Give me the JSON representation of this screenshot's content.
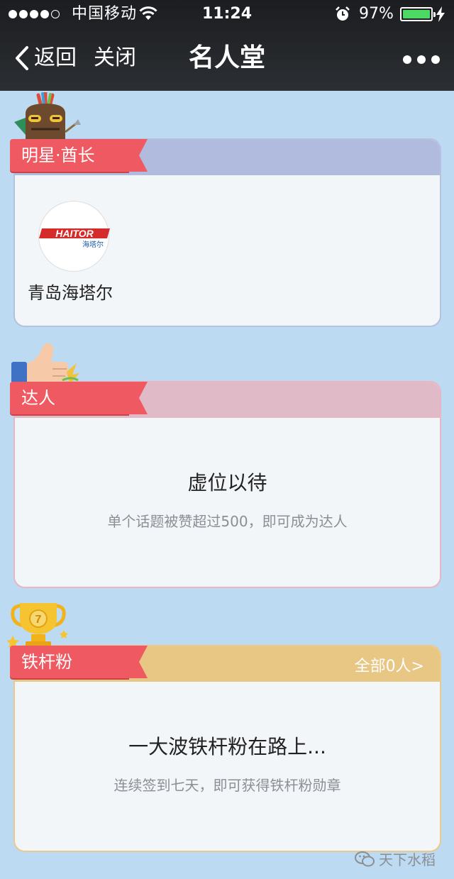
{
  "status_bar": {
    "carrier": "中国移动",
    "time": "11:24",
    "battery_percent": "97%",
    "signal_bars": 4,
    "battery_level": 0.97
  },
  "nav": {
    "back_label": "返回",
    "close_label": "关闭",
    "title": "名人堂"
  },
  "sections": {
    "stars": {
      "ribbon": "明星·酋长",
      "member_name": "青岛海塔尔",
      "logo_text": "HAITOR",
      "logo_sub": "海塔尔"
    },
    "experts": {
      "ribbon": "达人",
      "placeholder_title": "虚位以待",
      "placeholder_desc": "单个话题被赞超过500，即可成为达人"
    },
    "fans": {
      "ribbon": "铁杆粉",
      "all_link": "全部0人>",
      "placeholder_title": "一大波铁杆粉在路上...",
      "placeholder_desc": "连续签到七天，即可获得铁杆粉勋章",
      "trophy_number": "7"
    }
  },
  "watermark": "天下水稻",
  "colors": {
    "page_bg": "#bcdaf1",
    "ribbon": "#ef5a62",
    "stars_head": "#b1bbdd",
    "experts_head": "#e1bac7",
    "fans_head": "#e8c684"
  }
}
